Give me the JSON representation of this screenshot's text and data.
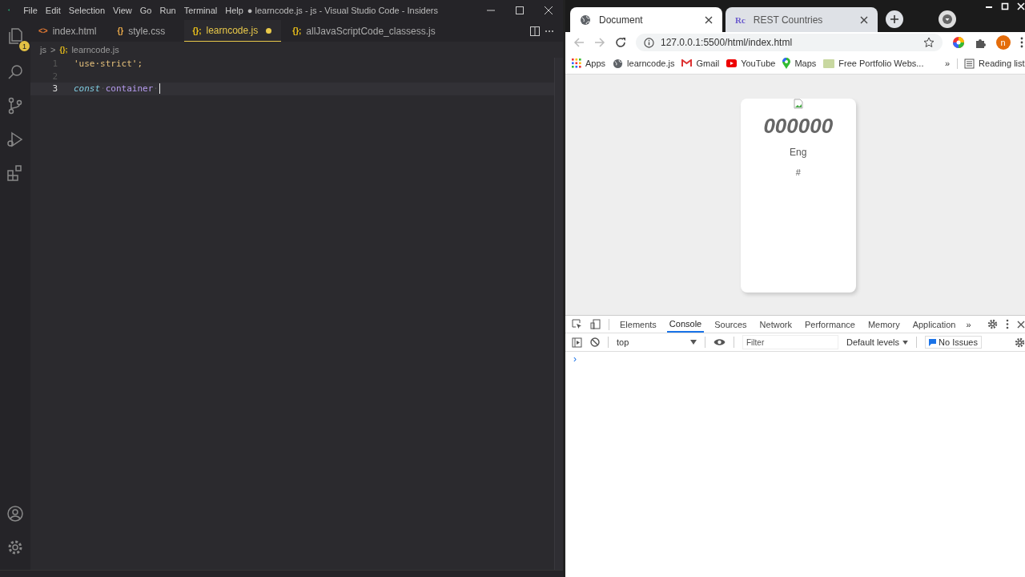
{
  "editor": {
    "menu": [
      "File",
      "Edit",
      "Selection",
      "View",
      "Go",
      "Run",
      "Terminal",
      "Help"
    ],
    "title": "● learncode.js - js - Visual Studio Code - Insiders",
    "explorer_badge": "1",
    "tabs": [
      {
        "label": "index.html",
        "icon": "<>",
        "kind": "html",
        "selected": false,
        "modified": false
      },
      {
        "label": "style.css",
        "icon": "{}",
        "kind": "css",
        "selected": false,
        "modified": false
      },
      {
        "label": "learncode.js",
        "icon": "{};",
        "kind": "js",
        "selected": true,
        "modified": true
      },
      {
        "label": "allJavaScriptCode_classess.js",
        "icon": "{};",
        "kind": "js",
        "selected": false,
        "modified": false
      }
    ],
    "breadcrumb": {
      "folder": "js",
      "separator": ">",
      "icon": "{};",
      "file": "learncode.js"
    },
    "lines": [
      {
        "number": "1",
        "current": false,
        "tokens": [
          {
            "text": "'use·strict';",
            "kind": "string"
          }
        ]
      },
      {
        "number": "2",
        "current": false
      },
      {
        "number": "3",
        "current": true,
        "tokens": [
          {
            "text": "const",
            "kind": "keyword"
          },
          {
            "text": "·",
            "kind": "space"
          },
          {
            "text": "container",
            "kind": "name"
          },
          {
            "text": "·",
            "kind": "space"
          }
        ]
      }
    ]
  },
  "browser": {
    "tabs": [
      {
        "label": "Document",
        "kind": "globe",
        "selected": true
      },
      {
        "label": "REST Countries",
        "kind": "rc",
        "favicon": "Rc",
        "selected": false
      }
    ],
    "url": "127.0.0.1:5500/html/index.html",
    "profile_initial": "n",
    "bookmarks": [
      {
        "label": "Apps",
        "kind": "apps"
      },
      {
        "label": "learncode.js",
        "kind": "globe"
      },
      {
        "label": "Gmail",
        "kind": "gmail"
      },
      {
        "label": "YouTube",
        "kind": "youtube"
      },
      {
        "label": "Maps",
        "kind": "maps"
      },
      {
        "label": "Free Portfolio Webs...",
        "kind": "folder"
      }
    ],
    "more_bookmarks": "»",
    "reading_list": "Reading list",
    "card": {
      "code": "000000",
      "lang": "Eng",
      "link": "#"
    },
    "devtools": {
      "tabs": [
        {
          "label": "Elements",
          "selected": false
        },
        {
          "label": "Console",
          "selected": true
        },
        {
          "label": "Sources",
          "selected": false
        },
        {
          "label": "Network",
          "selected": false
        },
        {
          "label": "Performance",
          "selected": false
        },
        {
          "label": "Memory",
          "selected": false
        },
        {
          "label": "Application",
          "selected": false
        }
      ],
      "more_tabs": "»",
      "context": "top",
      "filter_placeholder": "Filter",
      "levels": "Default levels",
      "issues": "No Issues",
      "prompt": "›"
    }
  }
}
